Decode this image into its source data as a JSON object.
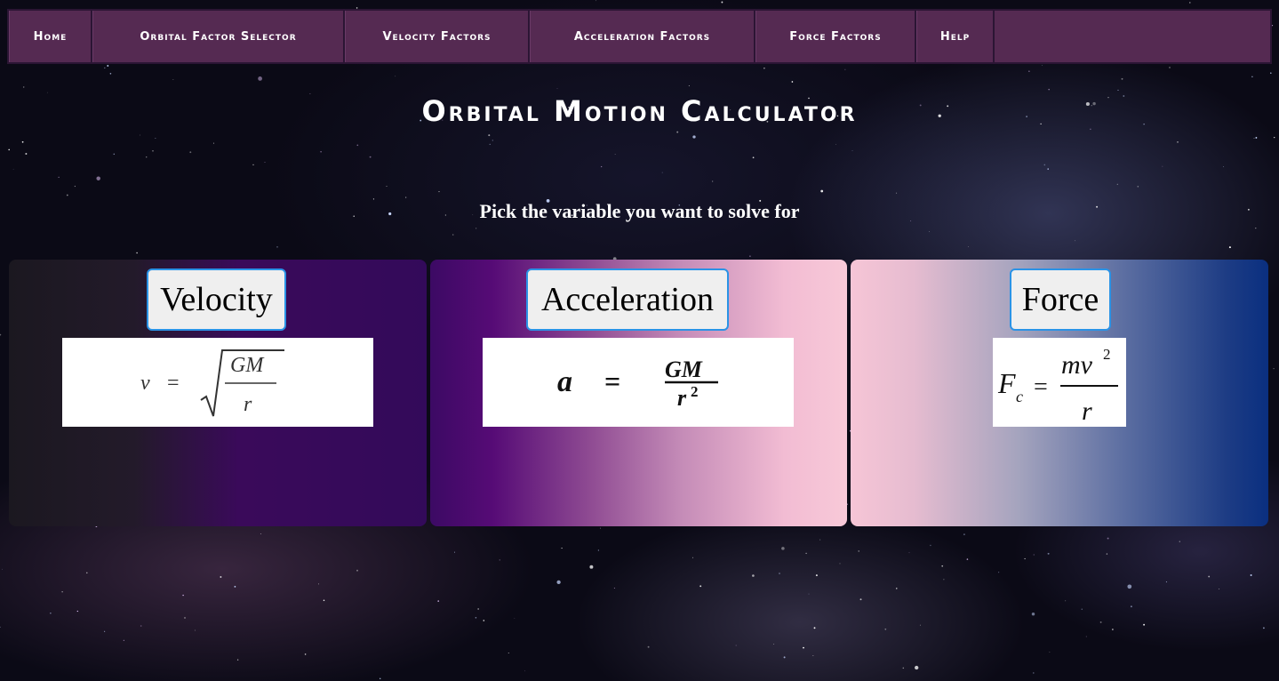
{
  "nav": {
    "items": [
      {
        "label": "Home"
      },
      {
        "label": "Orbital Factor Selector"
      },
      {
        "label": "Velocity Factors"
      },
      {
        "label": "Acceleration Factors"
      },
      {
        "label": "Force Factors"
      },
      {
        "label": "Help"
      }
    ]
  },
  "header": {
    "title": "Orbital Motion Calculator",
    "prompt": "Pick the variable you want to solve for"
  },
  "panels": {
    "velocity": {
      "button_label": "Velocity",
      "formula": {
        "lhs": "v",
        "op": "=",
        "num": "GM",
        "den": "r"
      }
    },
    "acceleration": {
      "button_label": "Acceleration",
      "formula": {
        "lhs": "a",
        "op": "=",
        "num": "GM",
        "den": "r",
        "den_exp": "2"
      }
    },
    "force": {
      "button_label": "Force",
      "formula": {
        "lhs": "F",
        "lhs_sub": "c",
        "op": "=",
        "num": "mv",
        "num_exp": "2",
        "den": "r"
      }
    }
  },
  "colors": {
    "nav_bg": "#552a52",
    "button_border": "#2a93e6",
    "button_bg": "#efefef"
  }
}
